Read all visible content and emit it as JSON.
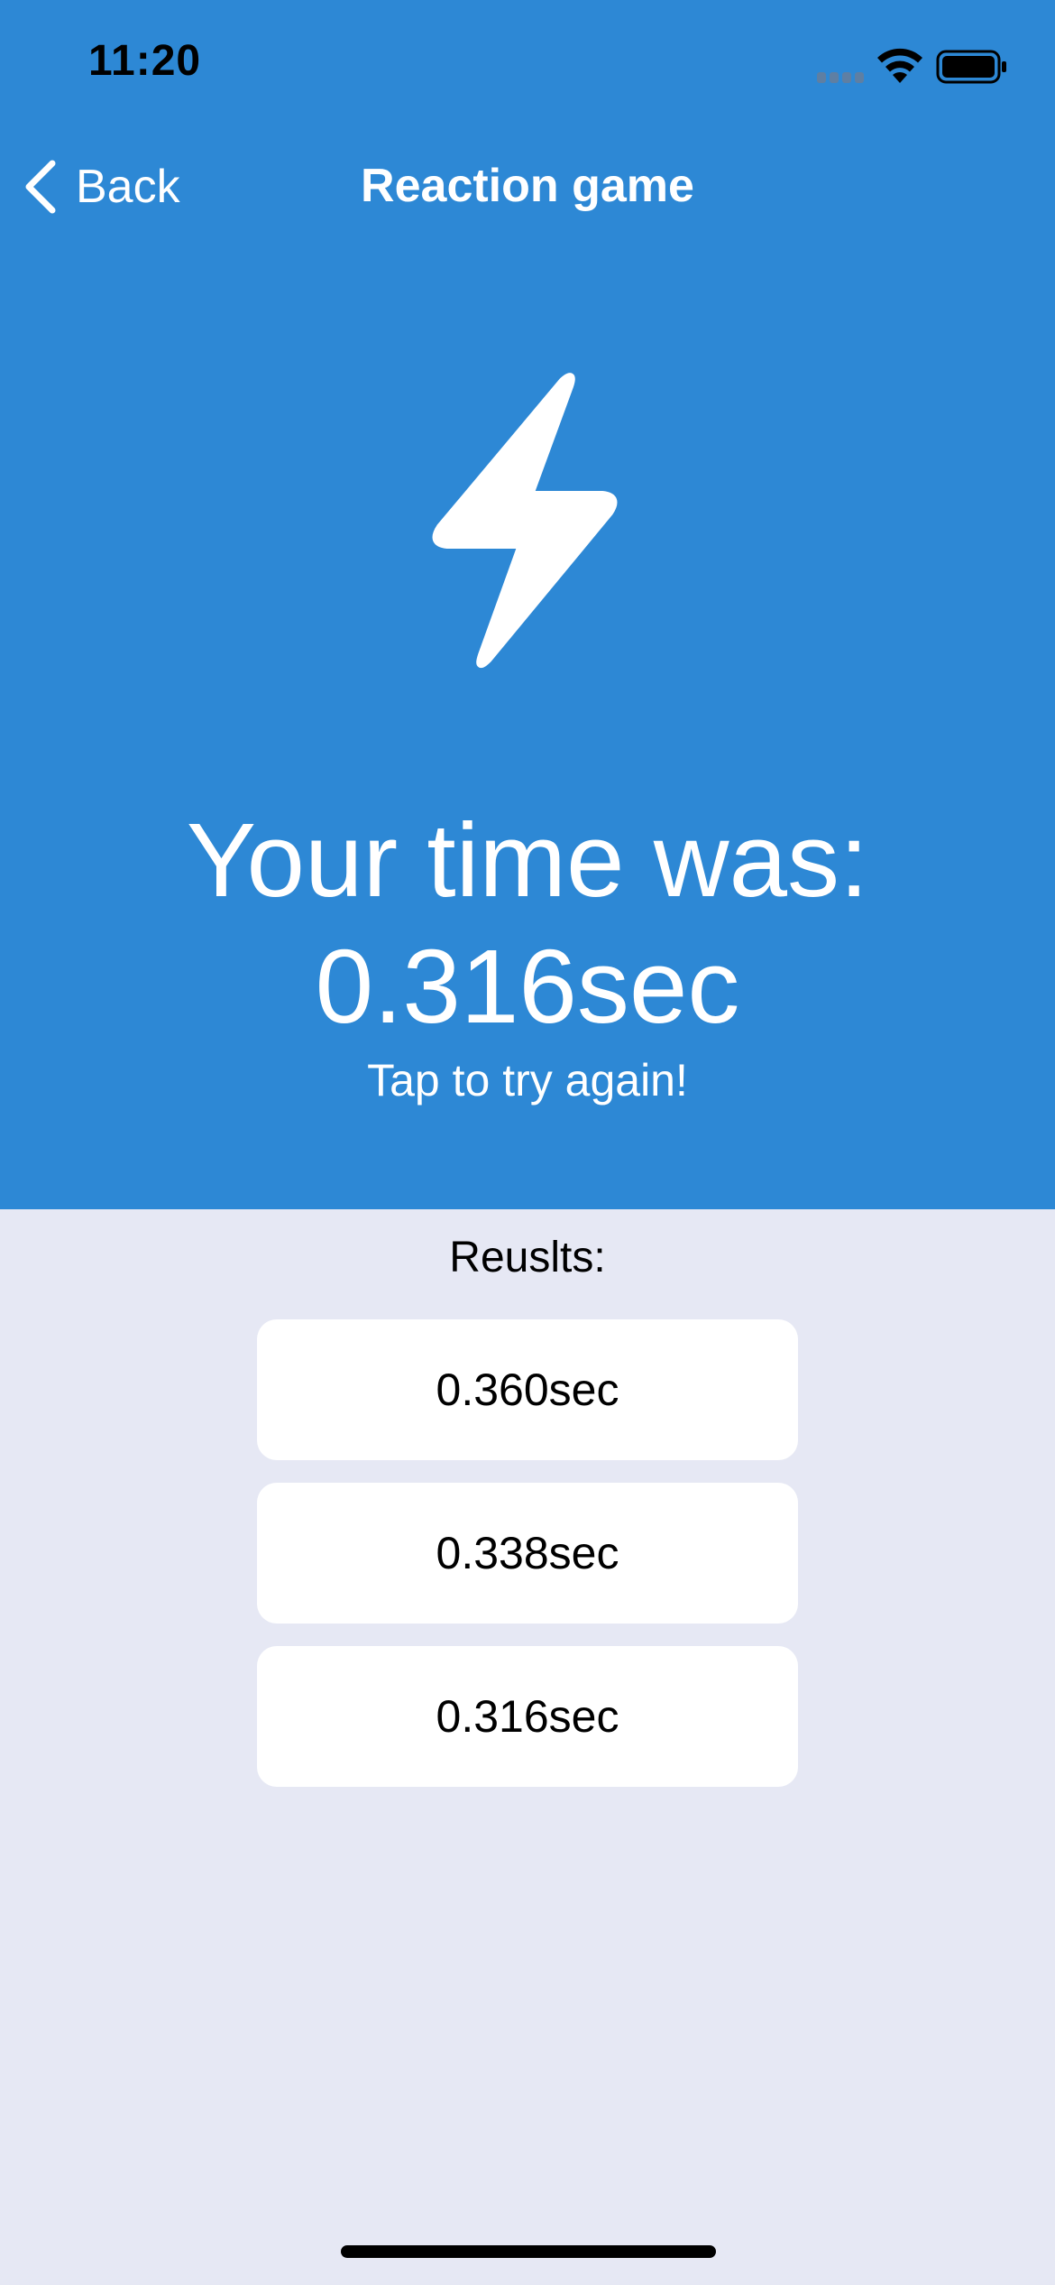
{
  "status_bar": {
    "time": "11:20",
    "icons": [
      "cellular-signal-icon",
      "wifi-icon",
      "battery-icon"
    ]
  },
  "nav": {
    "back_label": "Back",
    "back_icon": "chevron-left-icon",
    "title": "Reaction game"
  },
  "hero": {
    "icon": "lightning-bolt-icon",
    "headline": "Your time was:",
    "time": "0.316sec",
    "hint": "Tap to try again!"
  },
  "results": {
    "title": "Reuslts:",
    "items": [
      "0.360sec",
      "0.338sec",
      "0.316sec"
    ]
  },
  "colors": {
    "hero_background": "#2D88D5",
    "page_background": "#E6E8F4",
    "card_background": "#FFFFFF",
    "text_light": "#FFFFFF",
    "text_dark": "#000000"
  }
}
